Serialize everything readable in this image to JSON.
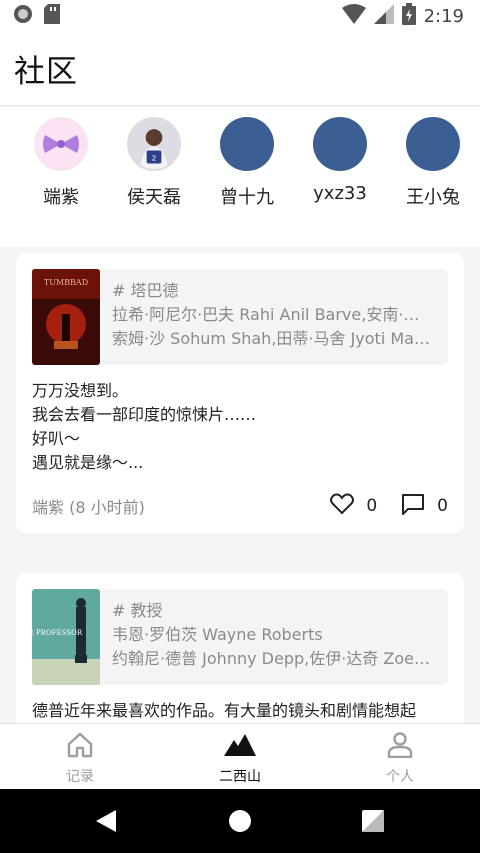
{
  "status_bar": {
    "time": "2:19"
  },
  "header": {
    "title": "社区"
  },
  "users": [
    {
      "name": "端紫",
      "avatar": "bow-avatar"
    },
    {
      "name": "侯天磊",
      "avatar": "photo-avatar"
    },
    {
      "name": "曾十九",
      "avatar": "blank-avatar"
    },
    {
      "name": "yxz33",
      "avatar": "blank-avatar"
    },
    {
      "name": "王小兔",
      "avatar": "blank-avatar"
    }
  ],
  "posts": [
    {
      "film_title": "# 塔巴德",
      "film_line1": "拉希·阿尼尔·巴夫 Rahi Anil Barve,安南·…",
      "film_line2": "索姆·沙 Sohum Shah,田蒂·马舍 Jyoti Ma…",
      "poster_text": "TUMBBAD",
      "text_lines": [
        "万万没想到。",
        "我会去看一部印度的惊悚片……",
        "好叭～",
        "遇见就是缘～..."
      ],
      "author": "端紫 (8 小时前)",
      "likes": "0",
      "comments": "0"
    },
    {
      "film_title": "# 教授",
      "film_line1": "韦恩·罗伯茨 Wayne Roberts",
      "film_line2": "约翰尼·德普 Johnny Depp,佐伊·达奇 Zoe…",
      "poster_text": "THE PROFESSOR",
      "text_lines": [
        "德普近年来最喜欢的作品。有大量的镜头和剧情能想起"
      ]
    }
  ],
  "bottom_nav": [
    {
      "label": "记录",
      "icon": "home-icon"
    },
    {
      "label": "二西山",
      "icon": "mountain-icon"
    },
    {
      "label": "个人",
      "icon": "person-icon"
    }
  ],
  "colors": {
    "accent": "#2f5d9a",
    "avatar_blue": "#3b5f92",
    "muted_text": "#8a8a8a"
  }
}
